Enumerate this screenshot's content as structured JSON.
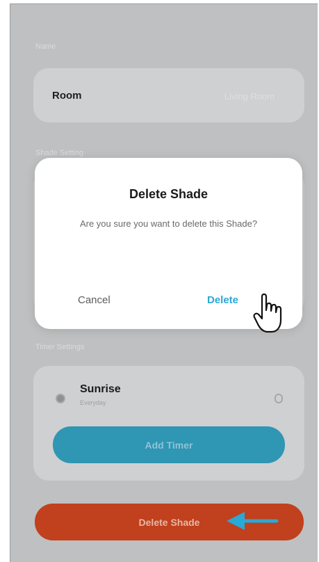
{
  "background": {
    "name_section_label": "Name",
    "room_label": "Room",
    "room_value": "Living Room",
    "shade_section_label": "Shade Setting",
    "timer_section_label": "Timer Settings",
    "timer": {
      "title": "Sunrise",
      "subtitle": "Everyday"
    },
    "add_timer_label": "Add Timer",
    "delete_shade_label": "Delete Shade"
  },
  "dialog": {
    "title": "Delete Shade",
    "message": "Are you sure you want to delete this Shade?",
    "cancel_label": "Cancel",
    "delete_label": "Delete"
  },
  "colors": {
    "overlay": "#bfc0c1",
    "accent_blue": "#2aa8d6",
    "add_timer_bg": "#2f96b3",
    "delete_bg": "#c1401d",
    "arrow": "#2aa8d6"
  },
  "icons": {
    "arrow": "arrow-left-icon",
    "cursor": "hand-pointer-icon",
    "sunrise": "sun-icon"
  }
}
